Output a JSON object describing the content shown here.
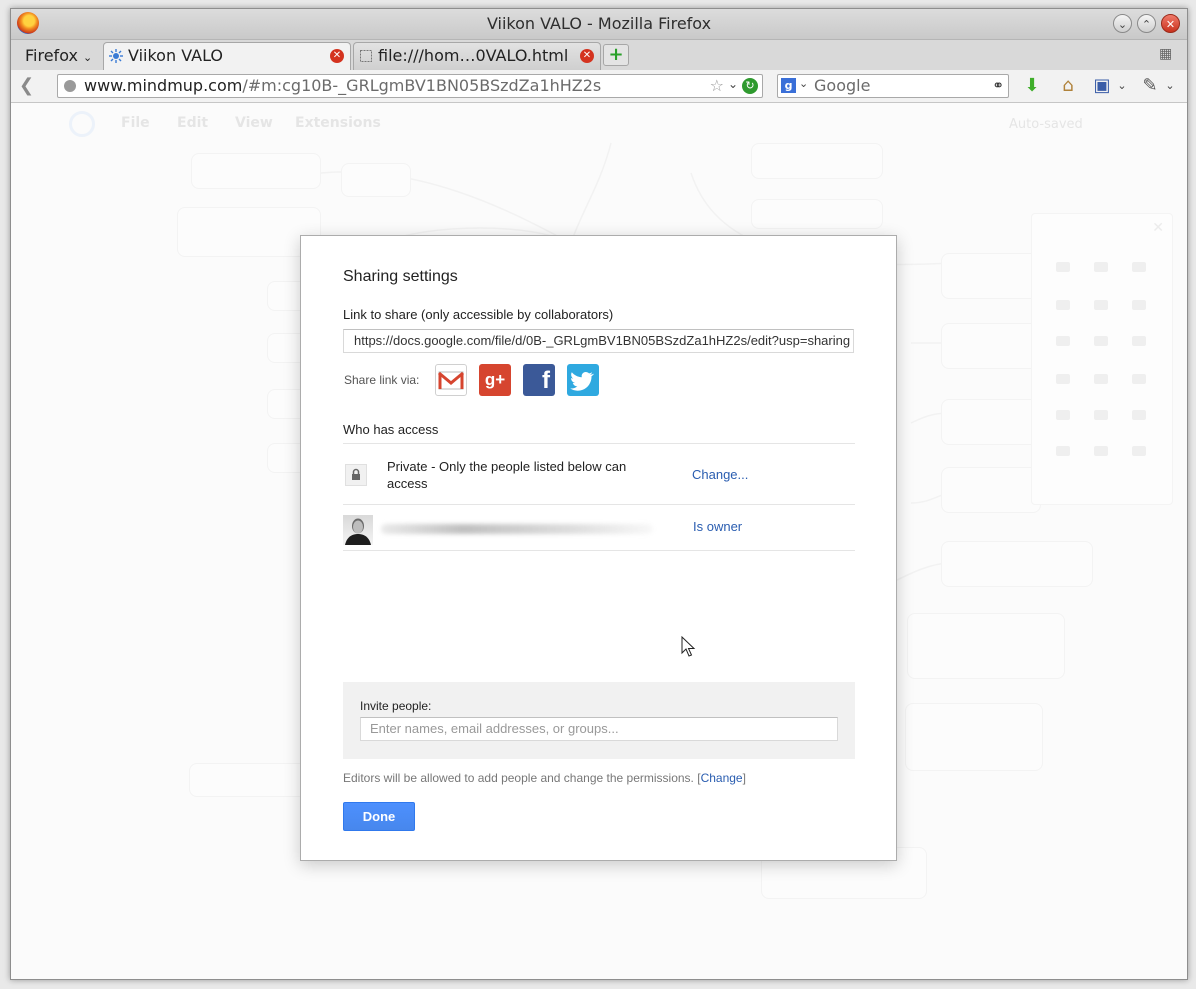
{
  "window": {
    "title": "Viikon VALO - Mozilla Firefox"
  },
  "browser": {
    "menu_label": "Firefox",
    "tabs": [
      {
        "label": "Viikon VALO",
        "active": true
      },
      {
        "label": "file:///hom…0VALO.html",
        "active": false
      }
    ],
    "url_domain": "www.mindmup.com",
    "url_path": "/#m:cg10B-_GRLgmBV1BN05BSzdZa1hHZ2s",
    "search_placeholder": "Google"
  },
  "app": {
    "menu": [
      "File",
      "Edit",
      "View",
      "Extensions"
    ],
    "status": "Auto-saved"
  },
  "dialog": {
    "title": "Sharing settings",
    "link_label": "Link to share (only accessible by collaborators)",
    "link_value": "https://docs.google.com/file/d/0B-_GRLgmBV1BN05BSzdZa1hHZ2s/edit?usp=sharing",
    "share_via_label": "Share link via:",
    "who_has_access": "Who has access",
    "private_text_line1": "Private - Only the people listed below can",
    "private_text_line2": "access",
    "change_label": "Change...",
    "owner_label": "Is owner",
    "invite_label": "Invite people:",
    "invite_placeholder": "Enter names, email addresses, or groups...",
    "note_text": "Editors will be allowed to add people and change the permissions.",
    "note_link": "Change",
    "done_label": "Done"
  },
  "colors": {
    "accent": "#4d90fe",
    "link": "#2a5db0"
  }
}
